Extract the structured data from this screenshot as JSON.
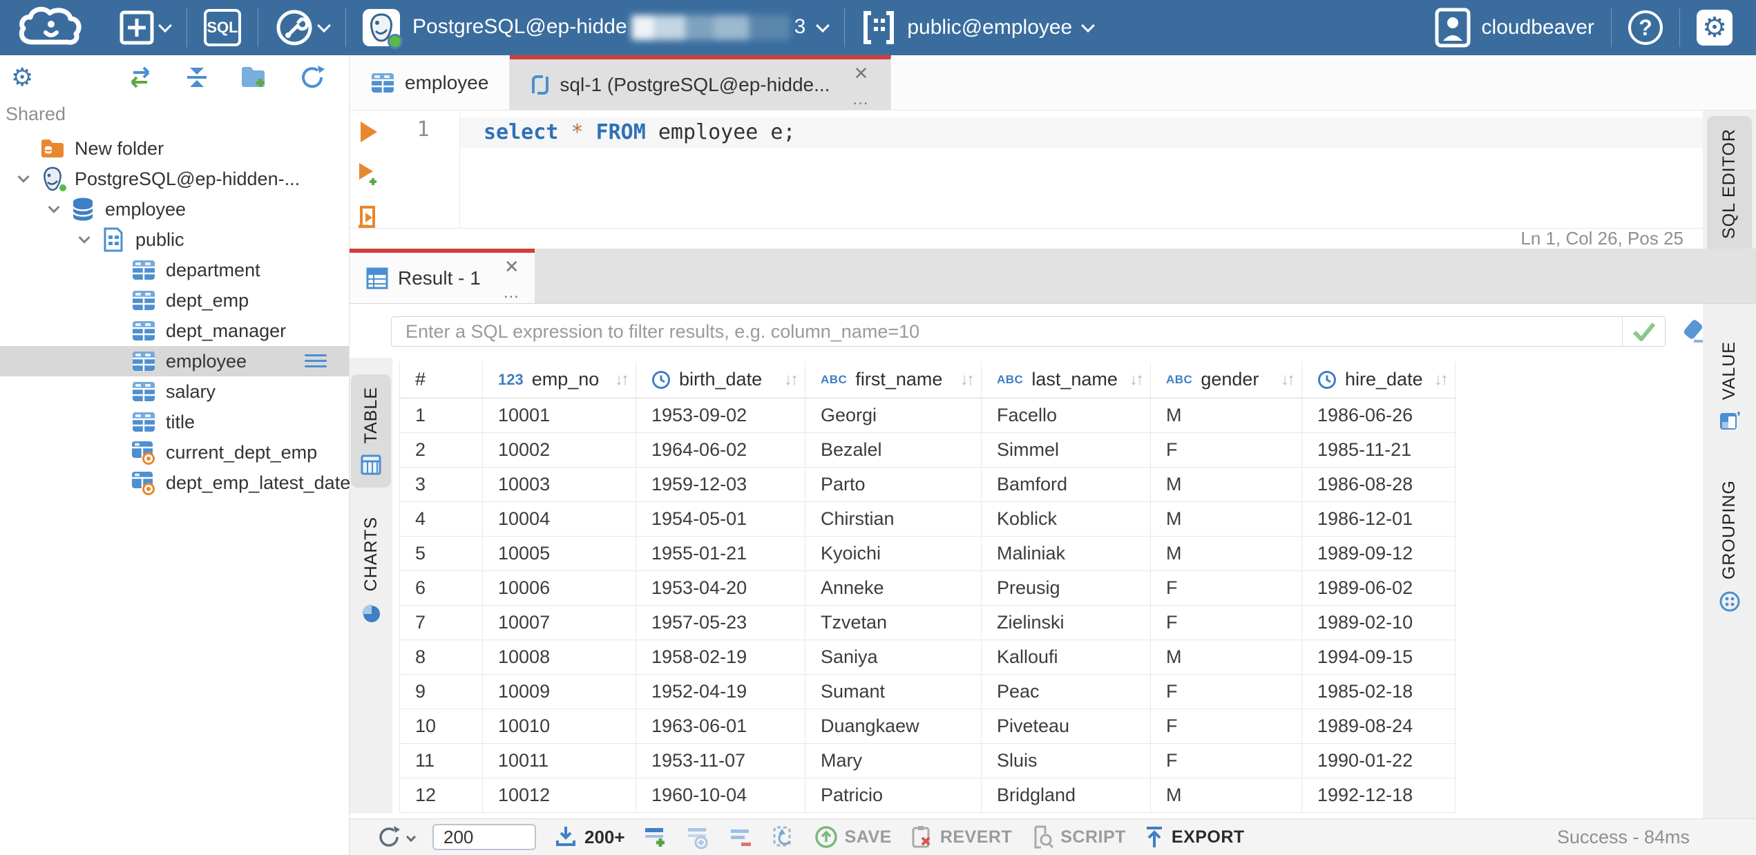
{
  "colors": {
    "header_bg": "#3a6d9e",
    "accent_red": "#cf3e3a",
    "icon_blue": "#4a8fd2",
    "icon_orange": "#e8872e",
    "icon_green": "#58ba47",
    "selected_gray": "#d8d8d8"
  },
  "header": {
    "connection": {
      "label": "PostgreSQL@ep-hidde",
      "redacted_tail": "3"
    },
    "schema": "public@employee",
    "user": "cloudbeaver",
    "sql_badge": "SQL"
  },
  "sidebar": {
    "section_label": "Shared",
    "tree": [
      {
        "label": "New folder",
        "icon": "folder",
        "depth": 0,
        "chevron": false
      },
      {
        "label": "PostgreSQL@ep-hidden-...",
        "icon": "postgres",
        "depth": 0,
        "chevron": true
      },
      {
        "label": "employee",
        "icon": "database",
        "depth": 1,
        "chevron": true
      },
      {
        "label": "public",
        "icon": "schema",
        "depth": 2,
        "chevron": true
      },
      {
        "label": "department",
        "icon": "table",
        "depth": 3,
        "chevron": false
      },
      {
        "label": "dept_emp",
        "icon": "table",
        "depth": 3,
        "chevron": false
      },
      {
        "label": "dept_manager",
        "icon": "table",
        "depth": 3,
        "chevron": false
      },
      {
        "label": "employee",
        "icon": "table",
        "depth": 3,
        "chevron": false,
        "selected": true
      },
      {
        "label": "salary",
        "icon": "table",
        "depth": 3,
        "chevron": false
      },
      {
        "label": "title",
        "icon": "table",
        "depth": 3,
        "chevron": false
      },
      {
        "label": "current_dept_emp",
        "icon": "view",
        "depth": 3,
        "chevron": false
      },
      {
        "label": "dept_emp_latest_date",
        "icon": "view",
        "depth": 3,
        "chevron": false
      }
    ]
  },
  "editor_tabs": [
    {
      "label": "employee",
      "icon": "table"
    },
    {
      "label": "sql-1 (PostgreSQL@ep-hidde...",
      "icon": "sql-script"
    }
  ],
  "sql": {
    "line_number": "1",
    "tokens": [
      {
        "text": "select",
        "type": "keyword"
      },
      {
        "text": " ",
        "type": "plain"
      },
      {
        "text": "*",
        "type": "operator"
      },
      {
        "text": " ",
        "type": "plain"
      },
      {
        "text": "FROM",
        "type": "keyword"
      },
      {
        "text": " employee e;",
        "type": "plain"
      }
    ],
    "caret_status": "Ln 1, Col 26, Pos 25"
  },
  "panels": {
    "table": "TABLE",
    "charts": "CHARTS",
    "sql_editor": "SQL EDITOR",
    "value": "VALUE",
    "grouping": "GROUPING"
  },
  "result": {
    "tab_label": "Result - 1",
    "filter_placeholder": "Enter a SQL expression to filter results, e.g. column_name=10",
    "status": "Success - 84ms",
    "toolbar": {
      "row_limit": "200",
      "fetch_more": "200+",
      "save": "SAVE",
      "revert": "REVERT",
      "script": "SCRIPT",
      "export": "EXPORT"
    },
    "grid": {
      "columns": [
        {
          "name": "#",
          "type": "rownum"
        },
        {
          "name": "emp_no",
          "type": "number"
        },
        {
          "name": "birth_date",
          "type": "date"
        },
        {
          "name": "first_name",
          "type": "string"
        },
        {
          "name": "last_name",
          "type": "string"
        },
        {
          "name": "gender",
          "type": "string"
        },
        {
          "name": "hire_date",
          "type": "date"
        }
      ],
      "rows": [
        [
          "1",
          "10001",
          "1953-09-02",
          "Georgi",
          "Facello",
          "M",
          "1986-06-26"
        ],
        [
          "2",
          "10002",
          "1964-06-02",
          "Bezalel",
          "Simmel",
          "F",
          "1985-11-21"
        ],
        [
          "3",
          "10003",
          "1959-12-03",
          "Parto",
          "Bamford",
          "M",
          "1986-08-28"
        ],
        [
          "4",
          "10004",
          "1954-05-01",
          "Chirstian",
          "Koblick",
          "M",
          "1986-12-01"
        ],
        [
          "5",
          "10005",
          "1955-01-21",
          "Kyoichi",
          "Maliniak",
          "M",
          "1989-09-12"
        ],
        [
          "6",
          "10006",
          "1953-04-20",
          "Anneke",
          "Preusig",
          "F",
          "1989-06-02"
        ],
        [
          "7",
          "10007",
          "1957-05-23",
          "Tzvetan",
          "Zielinski",
          "F",
          "1989-02-10"
        ],
        [
          "8",
          "10008",
          "1958-02-19",
          "Saniya",
          "Kalloufi",
          "M",
          "1994-09-15"
        ],
        [
          "9",
          "10009",
          "1952-04-19",
          "Sumant",
          "Peac",
          "F",
          "1985-02-18"
        ],
        [
          "10",
          "10010",
          "1963-06-01",
          "Duangkaew",
          "Piveteau",
          "F",
          "1989-08-24"
        ],
        [
          "11",
          "10011",
          "1953-11-07",
          "Mary",
          "Sluis",
          "F",
          "1990-01-22"
        ],
        [
          "12",
          "10012",
          "1960-10-04",
          "Patricio",
          "Bridgland",
          "M",
          "1992-12-18"
        ]
      ]
    }
  }
}
